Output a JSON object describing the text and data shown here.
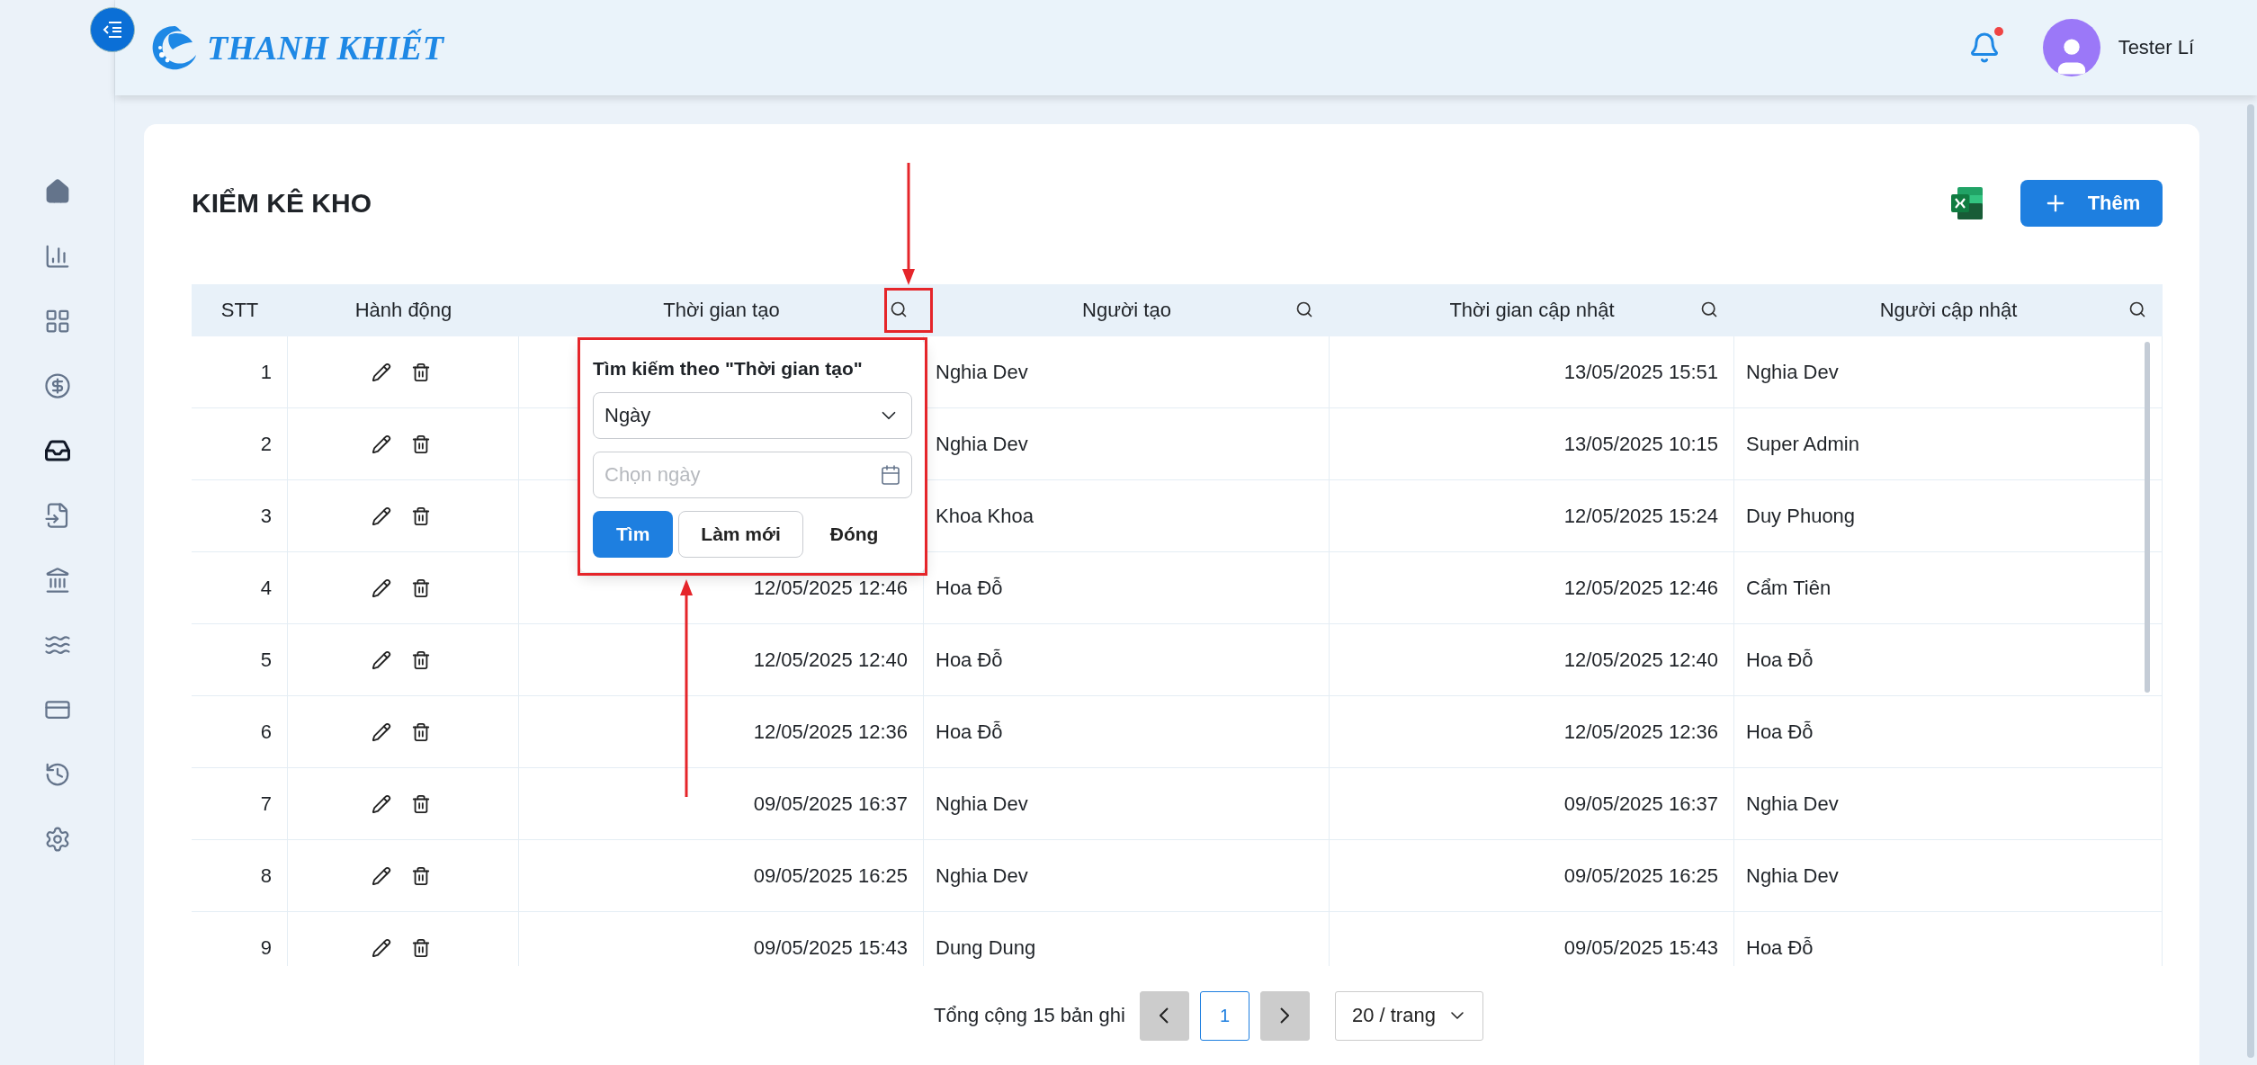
{
  "header": {
    "logo_text": "THANH KHIẾT",
    "notification": {
      "unread": true
    },
    "user_name": "Tester Lí"
  },
  "sidebar": {
    "items": [
      {
        "selected": false
      },
      {
        "selected": false
      },
      {
        "selected": false
      },
      {
        "selected": false
      },
      {
        "selected": true
      },
      {
        "selected": false
      },
      {
        "selected": false
      },
      {
        "selected": false
      },
      {
        "selected": false
      },
      {
        "selected": false
      },
      {
        "selected": false
      }
    ]
  },
  "page": {
    "title": "KIỂM KÊ KHO",
    "add_button": "Thêm"
  },
  "table": {
    "columns": [
      {
        "label": "STT",
        "searchable": false
      },
      {
        "label": "Hành động",
        "searchable": false
      },
      {
        "label": "Thời gian tạo",
        "searchable": true
      },
      {
        "label": "Người tạo",
        "searchable": true
      },
      {
        "label": "Thời gian cập nhật",
        "searchable": true
      },
      {
        "label": "Người cập nhật",
        "searchable": true
      }
    ],
    "rows": [
      {
        "stt": "1",
        "creator": "Nghia Dev",
        "updated_at": "13/05/2025 15:51",
        "updater": "Nghia Dev"
      },
      {
        "stt": "2",
        "creator": "Nghia Dev",
        "updated_at": "13/05/2025 10:15",
        "updater": "Super Admin"
      },
      {
        "stt": "3",
        "creator": "Khoa Khoa",
        "updated_at": "12/05/2025 15:24",
        "updater": "Duy Phuong"
      },
      {
        "stt": "4",
        "created_at": "12/05/2025 12:46",
        "creator": "Hoa Đỗ",
        "updated_at": "12/05/2025 12:46",
        "updater": "Cẩm Tiên"
      },
      {
        "stt": "5",
        "created_at": "12/05/2025 12:40",
        "creator": "Hoa Đỗ",
        "updated_at": "12/05/2025 12:40",
        "updater": "Hoa Đỗ"
      },
      {
        "stt": "6",
        "created_at": "12/05/2025 12:36",
        "creator": "Hoa Đỗ",
        "updated_at": "12/05/2025 12:36",
        "updater": "Hoa Đỗ"
      },
      {
        "stt": "7",
        "created_at": "09/05/2025 16:37",
        "creator": "Nghia Dev",
        "updated_at": "09/05/2025 16:37",
        "updater": "Nghia Dev"
      },
      {
        "stt": "8",
        "created_at": "09/05/2025 16:25",
        "creator": "Nghia Dev",
        "updated_at": "09/05/2025 16:25",
        "updater": "Nghia Dev"
      },
      {
        "stt": "9",
        "created_at": "09/05/2025 15:43",
        "creator": "Dung Dung",
        "updated_at": "09/05/2025 15:43",
        "updater": "Hoa Đỗ"
      }
    ]
  },
  "search_popup": {
    "title": "Tìm kiếm theo \"Thời gian tạo\"",
    "mode_select": "Ngày",
    "date_field": {
      "placeholder": "Chọn ngày"
    },
    "buttons": [
      {
        "label": "Tìm",
        "kind": "primary"
      },
      {
        "label": "Làm mới",
        "kind": "default"
      },
      {
        "label": "Đóng",
        "kind": "text"
      }
    ]
  },
  "pagination": {
    "total": "Tổng cộng 15 bản ghi",
    "prev": {
      "disabled": true
    },
    "pages": [
      {
        "label": "1",
        "selected": true
      }
    ],
    "next": {
      "disabled": true
    },
    "page_size": "20 / trang"
  },
  "annotations": {
    "frames": true,
    "arrows": true
  }
}
